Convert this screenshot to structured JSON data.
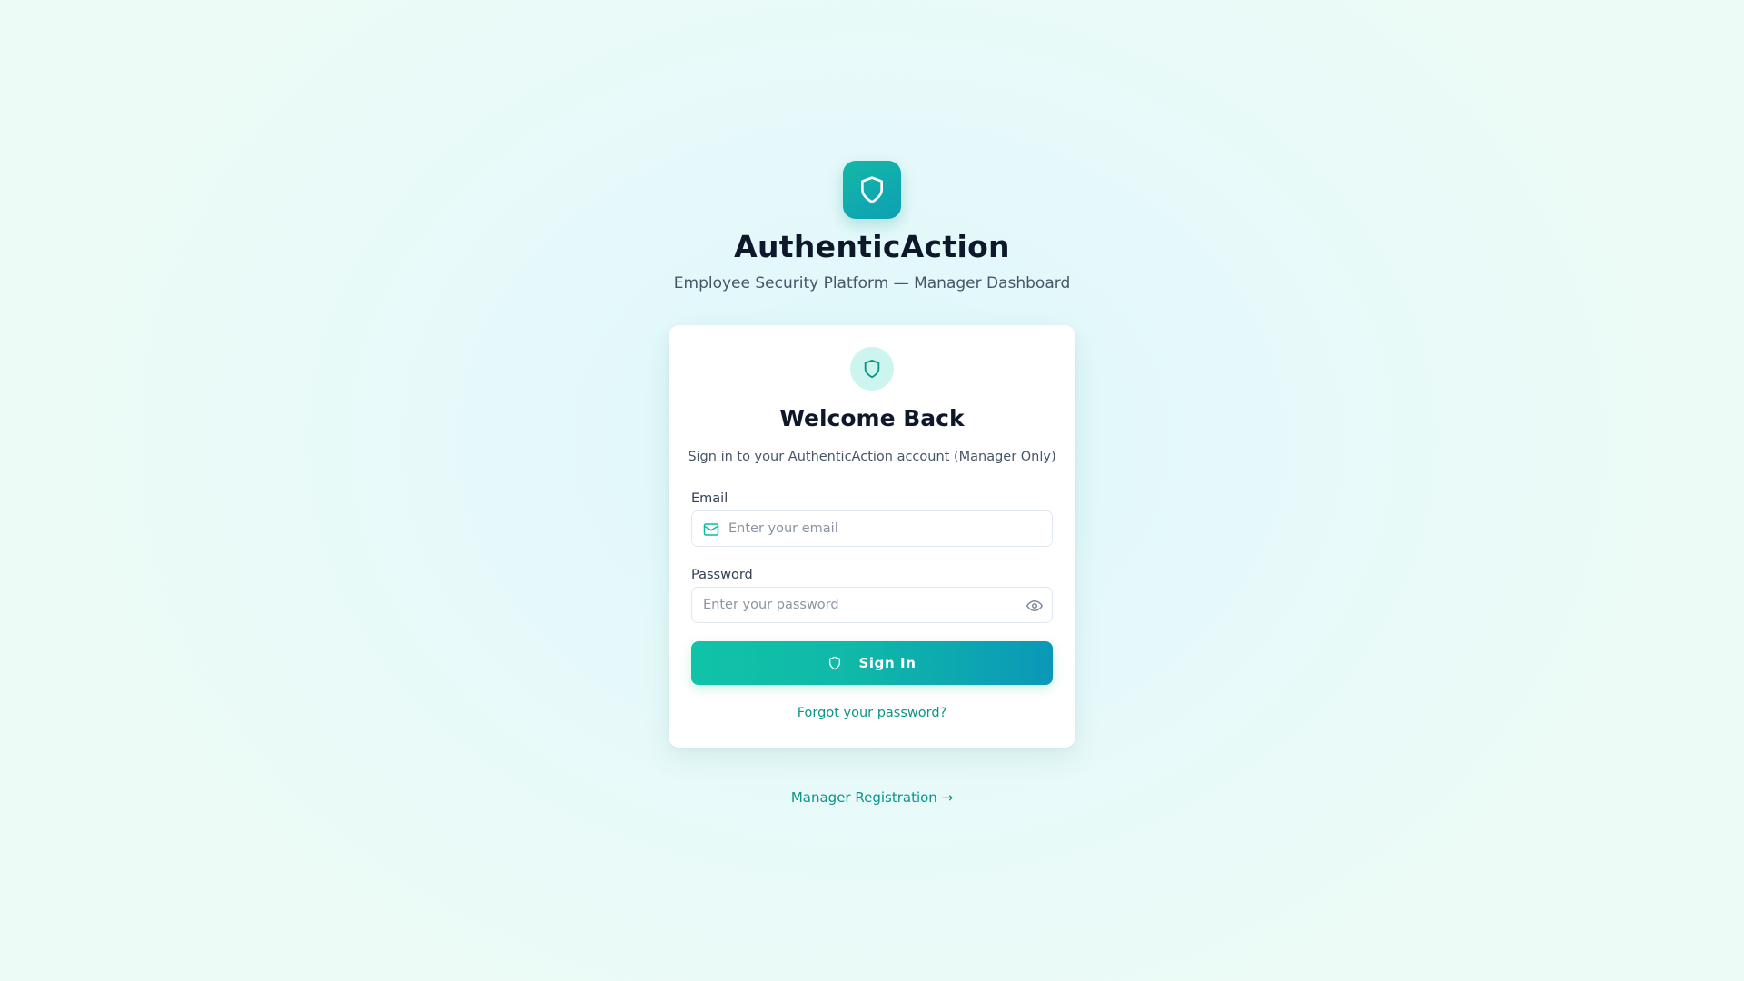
{
  "brand": {
    "logo_icon": "shield-icon",
    "title": "AuthenticAction",
    "subtitle": "Employee Security Platform — Manager Dashboard"
  },
  "login_card": {
    "icon": "shield-icon",
    "title": "Welcome Back",
    "subtitle": "Sign in to your AuthenticAction account (Manager Only)",
    "email": {
      "label": "Email",
      "placeholder": "Enter your email",
      "value": "",
      "icon": "mail-icon"
    },
    "password": {
      "label": "Password",
      "placeholder": "Enter your password",
      "value": "",
      "toggle_icon": "eye-icon"
    },
    "sign_in_label": "Sign In",
    "sign_in_icon": "shield-icon",
    "forgot_label": "Forgot your password?"
  },
  "register_link": "Manager Registration →",
  "colors": {
    "accent": "#0d9488",
    "button_gradient_start": "#10c3a8",
    "button_gradient_end": "#0a98b8",
    "title_text": "#0f172a",
    "muted_text": "#475569"
  }
}
